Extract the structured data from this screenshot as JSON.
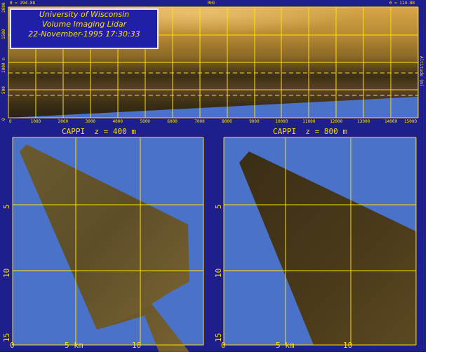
{
  "top_panel": {
    "title_lines": [
      "University of Wisconsin",
      "Volume Imaging Lidar",
      "22-November-1995 17:30:33"
    ],
    "left_readout": "θ = 294.88",
    "center_label": "RHI",
    "right_readout": "θ = 114.88",
    "right_axis_label": "Altitude (m)",
    "y_ticks": [
      "0",
      "500",
      "1000 m",
      "1500",
      "2000"
    ],
    "x_ticks": [
      "0",
      "1000",
      "2000",
      "3000",
      "4000",
      "5000",
      "6000",
      "7000",
      "8000",
      "9000",
      "10000",
      "11000",
      "12000",
      "13000",
      "14000",
      "15000"
    ]
  },
  "left_panel": {
    "title": "CAPPI  z = 400 m",
    "y_ticks": [
      "5",
      "10",
      "15"
    ],
    "x_ticks": [
      "0",
      "5 km",
      "10"
    ]
  },
  "right_panel": {
    "title": "CAPPI  z = 800 m",
    "y_ticks": [
      "5",
      "10",
      "15"
    ],
    "x_ticks": [
      "0",
      "5 km",
      "10"
    ]
  },
  "colors": {
    "frame": "#1e1e8c",
    "sky": "#4a72c8",
    "grid": "#ffe000",
    "lidar_light": "#c89a3a",
    "lidar_dark": "#3a2e14"
  }
}
